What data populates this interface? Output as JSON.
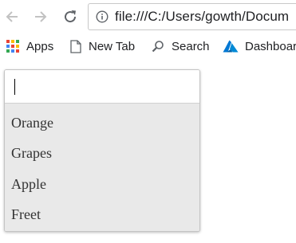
{
  "browser": {
    "url": "file:///C:/Users/gowth/Docum",
    "icons": {
      "back": "arrow-left-icon",
      "forward": "arrow-right-icon",
      "reload": "reload-icon",
      "info": "info-icon"
    }
  },
  "bookmarks": [
    {
      "label": "Apps",
      "icon": "apps-grid-icon"
    },
    {
      "label": "New Tab",
      "icon": "page-icon"
    },
    {
      "label": "Search",
      "icon": "search-icon"
    },
    {
      "label": "Dashboar",
      "icon": "azure-icon"
    }
  ],
  "autocomplete": {
    "input_value": "",
    "options": [
      "Orange",
      "Grapes",
      "Apple",
      "Freet"
    ]
  },
  "colors": {
    "list_background": "#e9e9e9",
    "azure": "#0078d4"
  }
}
